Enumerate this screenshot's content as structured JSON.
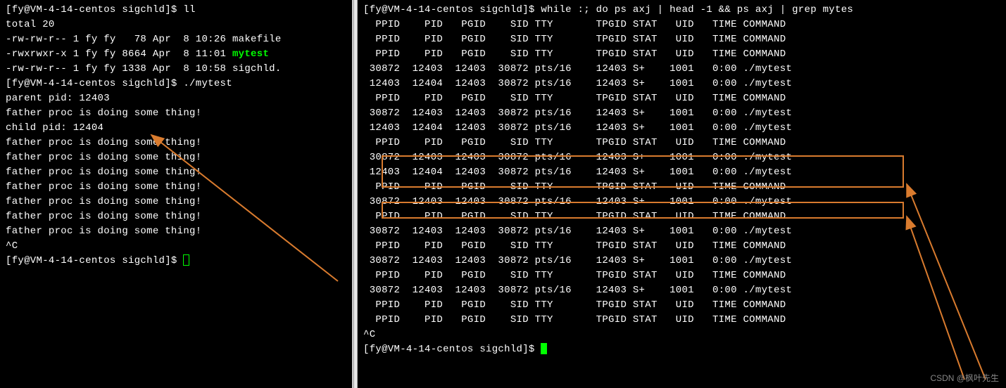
{
  "left": {
    "lines": [
      {
        "segments": [
          {
            "t": "[fy@VM-4-14-centos sigchld]$ ll"
          }
        ]
      },
      {
        "segments": [
          {
            "t": "total 20"
          }
        ]
      },
      {
        "segments": [
          {
            "t": "-rw-rw-r-- 1 fy fy   78 Apr  8 10:26 makefile"
          }
        ]
      },
      {
        "segments": [
          {
            "t": "-rwxrwxr-x 1 fy fy 8664 Apr  8 11:01 "
          },
          {
            "t": "mytest",
            "c": "highlight-file"
          }
        ]
      },
      {
        "segments": [
          {
            "t": "-rw-rw-r-- 1 fy fy 1338 Apr  8 10:58 sigchld."
          }
        ]
      },
      {
        "segments": [
          {
            "t": "[fy@VM-4-14-centos sigchld]$ ./mytest"
          }
        ]
      },
      {
        "segments": [
          {
            "t": "parent pid: 12403"
          }
        ]
      },
      {
        "segments": [
          {
            "t": "father proc is doing some thing!"
          }
        ]
      },
      {
        "segments": [
          {
            "t": "child pid: 12404"
          }
        ]
      },
      {
        "segments": [
          {
            "t": "father proc is doing some thing!"
          }
        ]
      },
      {
        "segments": [
          {
            "t": "father proc is doing some thing!"
          }
        ]
      },
      {
        "segments": [
          {
            "t": "father proc is doing some thing!"
          }
        ]
      },
      {
        "segments": [
          {
            "t": "father proc is doing some thing!"
          }
        ]
      },
      {
        "segments": [
          {
            "t": "father proc is doing some thing!"
          }
        ]
      },
      {
        "segments": [
          {
            "t": "father proc is doing some thing!"
          }
        ]
      },
      {
        "segments": [
          {
            "t": "father proc is doing some thing!"
          }
        ]
      },
      {
        "segments": [
          {
            "t": "^C"
          }
        ]
      },
      {
        "segments": [
          {
            "t": "[fy@VM-4-14-centos sigchld]$ "
          }
        ],
        "cursor": "outline"
      }
    ]
  },
  "right": {
    "lines": [
      {
        "segments": [
          {
            "t": "[fy@VM-4-14-centos sigchld]$ while :; do ps axj | head -1 && ps axj | grep mytes"
          }
        ]
      },
      {
        "segments": [
          {
            "t": "  PPID    PID   PGID    SID TTY       TPGID STAT   UID   TIME COMMAND"
          }
        ]
      },
      {
        "segments": [
          {
            "t": "  PPID    PID   PGID    SID TTY       TPGID STAT   UID   TIME COMMAND"
          }
        ]
      },
      {
        "segments": [
          {
            "t": "  PPID    PID   PGID    SID TTY       TPGID STAT   UID   TIME COMMAND"
          }
        ]
      },
      {
        "segments": [
          {
            "t": " 30872  12403  12403  30872 pts/16    12403 S+    1001   0:00 ./mytest"
          }
        ]
      },
      {
        "segments": [
          {
            "t": " 12403  12404  12403  30872 pts/16    12403 S+    1001   0:00 ./mytest"
          }
        ]
      },
      {
        "segments": [
          {
            "t": "  PPID    PID   PGID    SID TTY       TPGID STAT   UID   TIME COMMAND"
          }
        ]
      },
      {
        "segments": [
          {
            "t": " 30872  12403  12403  30872 pts/16    12403 S+    1001   0:00 ./mytest"
          }
        ]
      },
      {
        "segments": [
          {
            "t": " 12403  12404  12403  30872 pts/16    12403 S+    1001   0:00 ./mytest"
          }
        ]
      },
      {
        "segments": [
          {
            "t": "  PPID    PID   PGID    SID TTY       TPGID STAT   UID   TIME COMMAND"
          }
        ]
      },
      {
        "segments": [
          {
            "t": " 30872  12403  12403  30872 pts/16    12403 S+    1001   0:00 ./mytest"
          }
        ]
      },
      {
        "segments": [
          {
            "t": " 12403  12404  12403  30872 pts/16    12403 S+    1001   0:00 ./mytest"
          }
        ]
      },
      {
        "segments": [
          {
            "t": "  PPID    PID   PGID    SID TTY       TPGID STAT   UID   TIME COMMAND"
          }
        ]
      },
      {
        "segments": [
          {
            "t": " 30872  12403  12403  30872 pts/16    12403 S+    1001   0:00 ./mytest"
          }
        ]
      },
      {
        "segments": [
          {
            "t": "  PPID    PID   PGID    SID TTY       TPGID STAT   UID   TIME COMMAND"
          }
        ]
      },
      {
        "segments": [
          {
            "t": " 30872  12403  12403  30872 pts/16    12403 S+    1001   0:00 ./mytest"
          }
        ]
      },
      {
        "segments": [
          {
            "t": "  PPID    PID   PGID    SID TTY       TPGID STAT   UID   TIME COMMAND"
          }
        ]
      },
      {
        "segments": [
          {
            "t": " 30872  12403  12403  30872 pts/16    12403 S+    1001   0:00 ./mytest"
          }
        ]
      },
      {
        "segments": [
          {
            "t": "  PPID    PID   PGID    SID TTY       TPGID STAT   UID   TIME COMMAND"
          }
        ]
      },
      {
        "segments": [
          {
            "t": " 30872  12403  12403  30872 pts/16    12403 S+    1001   0:00 ./mytest"
          }
        ]
      },
      {
        "segments": [
          {
            "t": "  PPID    PID   PGID    SID TTY       TPGID STAT   UID   TIME COMMAND"
          }
        ]
      },
      {
        "segments": [
          {
            "t": "  PPID    PID   PGID    SID TTY       TPGID STAT   UID   TIME COMMAND"
          }
        ]
      },
      {
        "segments": [
          {
            "t": "^C"
          }
        ]
      },
      {
        "segments": [
          {
            "t": "[fy@VM-4-14-centos sigchld]$ "
          }
        ],
        "cursor": "solid"
      }
    ]
  },
  "watermark": "CSDN @枫叶先生"
}
